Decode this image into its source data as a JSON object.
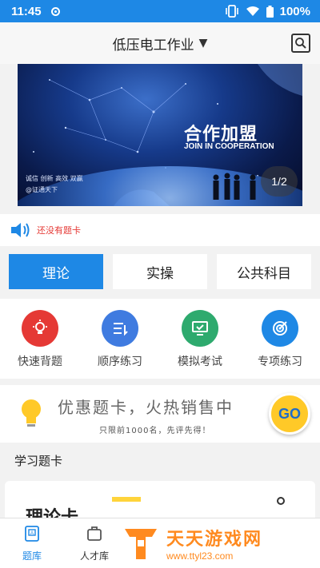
{
  "status_bar": {
    "time": "11:45",
    "battery": "100%"
  },
  "header": {
    "title": "低压电工作业",
    "dropdown_glyph": "▼"
  },
  "banner": {
    "headline": "合作加盟",
    "subheadline": "JOIN IN COOPERATION",
    "slogan": "诚信 创新 高效 双赢",
    "brand": "@证通天下",
    "pager": "1/2"
  },
  "notice": {
    "text": "还没有题卡"
  },
  "tabs": [
    {
      "label": "理论",
      "active": true
    },
    {
      "label": "实操",
      "active": false
    },
    {
      "label": "公共科目",
      "active": false
    }
  ],
  "grid": [
    {
      "label": "快速背题",
      "icon": "lightbulb-icon",
      "color": "#e53935"
    },
    {
      "label": "顺序练习",
      "icon": "list-order-icon",
      "color": "#3f7be0"
    },
    {
      "label": "模拟考试",
      "icon": "monitor-icon",
      "color": "#2eaa6e"
    },
    {
      "label": "专项练习",
      "icon": "target-icon",
      "color": "#1e88e5"
    }
  ],
  "promo": {
    "title": "优惠题卡，火热销售中",
    "subtitle": "只限前1000名，先评先得！",
    "go_label": "GO"
  },
  "section": {
    "title": "学习题卡"
  },
  "card": {
    "title": "理论卡"
  },
  "bottom_nav": [
    {
      "label": "题库",
      "icon": "question-bank-icon",
      "active": true
    },
    {
      "label": "人才库",
      "icon": "briefcase-icon",
      "active": false
    }
  ],
  "watermark": {
    "title": "天天游戏网",
    "url": "www.ttyl23.com"
  },
  "colors": {
    "primary": "#1e88e5",
    "alert": "#e53935",
    "go_bg": "#ffc928",
    "watermark": "#ff8a1f"
  }
}
